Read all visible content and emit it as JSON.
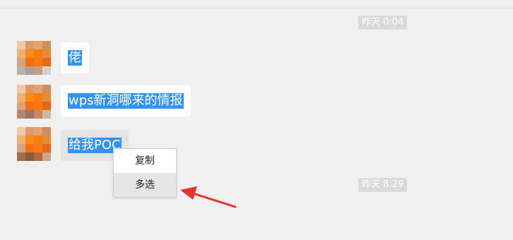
{
  "timestamps": [
    "昨天 0:04",
    "昨天 8:29"
  ],
  "messages": [
    {
      "text": "佬"
    },
    {
      "text": "wps新洞哪来的情报"
    },
    {
      "text": "给我POC"
    }
  ],
  "context_menu": {
    "items": [
      {
        "label": "复制"
      },
      {
        "label": "多选"
      }
    ]
  },
  "annotation": {
    "arrow_color": "#e8322f"
  }
}
